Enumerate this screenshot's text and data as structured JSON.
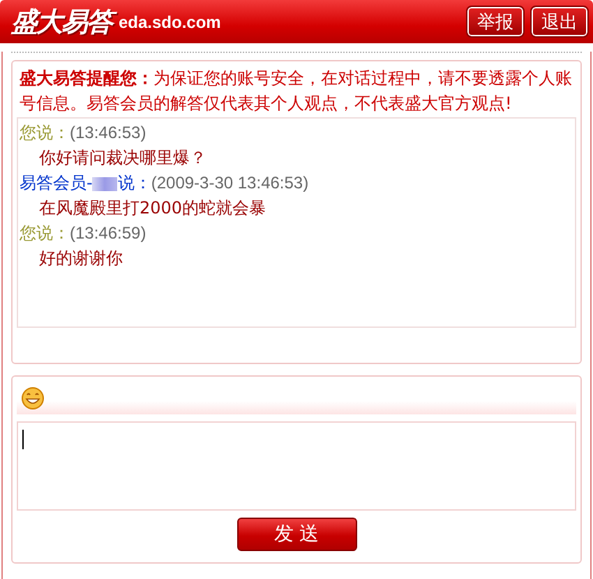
{
  "header": {
    "logo": "盛大易答",
    "domain": "eda.sdo.com",
    "buttons": [
      "举报",
      "退出"
    ]
  },
  "notice": {
    "title": "盛大易答提醒您：",
    "text": "为保证您的账号安全，在对话过程中，请不要透露个人账号信息。易答会员的解答仅代表其个人观点，不代表盛大官方观点!"
  },
  "messages": [
    {
      "kind": "self",
      "speaker": "您说：",
      "time": "(13:46:53)",
      "text": "你好请问裁决哪里爆？"
    },
    {
      "kind": "member",
      "speaker": "易答会员-",
      "speaker_suffix": "说：",
      "time": "(2009-3-30 13:46:53)",
      "text": "在风魔殿里打2000的蛇就会暴"
    },
    {
      "kind": "self",
      "speaker": "您说：",
      "time": "(13:46:59)",
      "text": "好的谢谢你"
    }
  ],
  "compose": {
    "send_button": "发 送"
  }
}
